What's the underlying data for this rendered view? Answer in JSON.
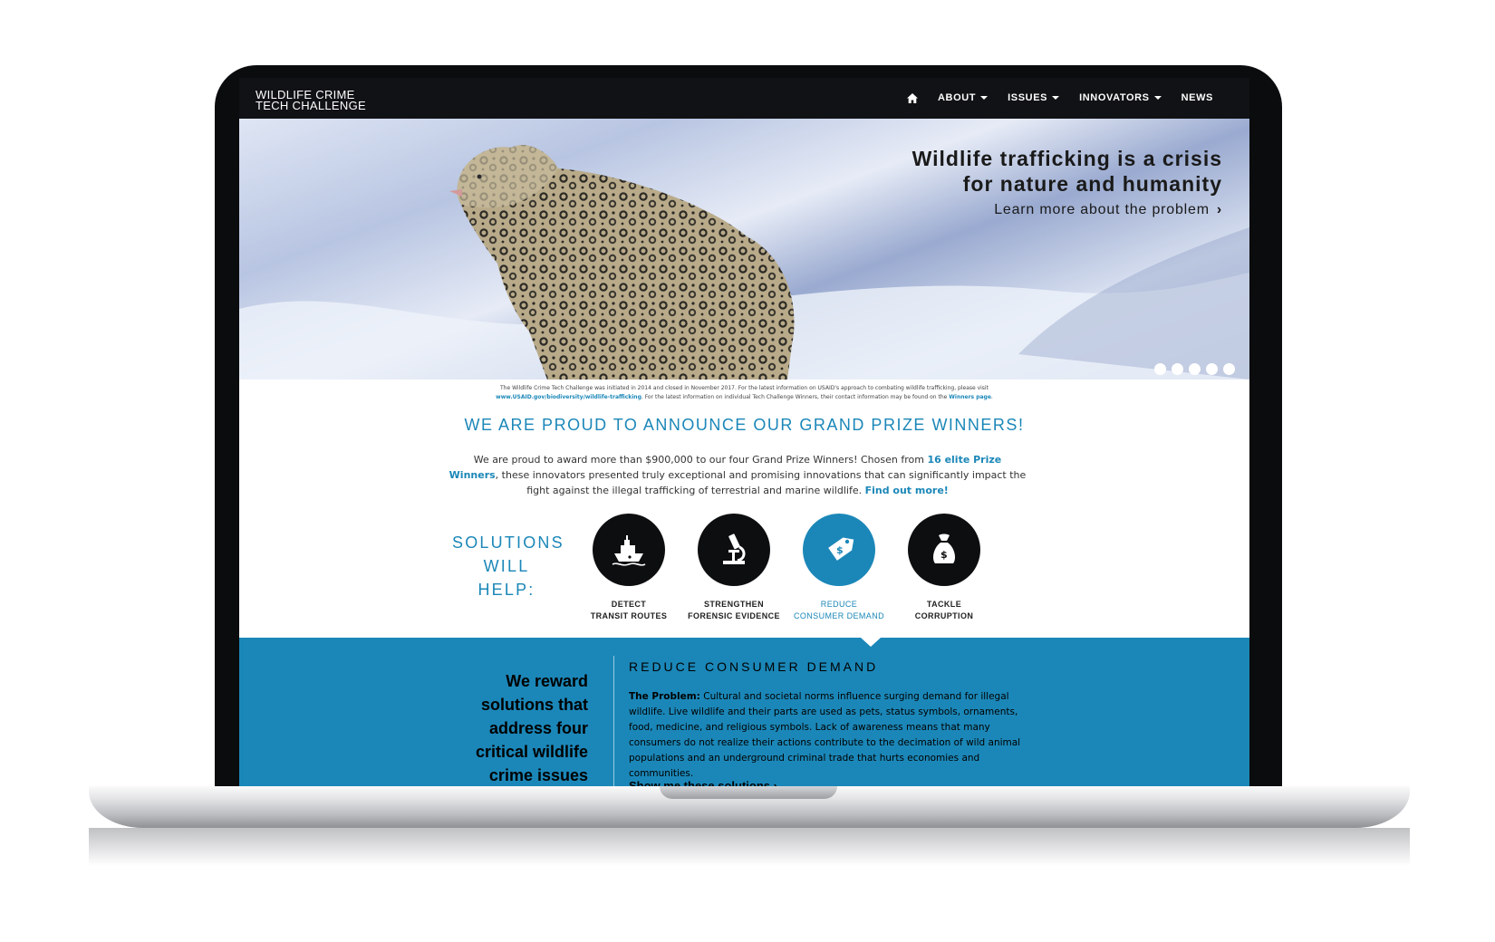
{
  "site": {
    "logo_line1": "WILDLIFE CRIME",
    "logo_line2": "TECH CHALLENGE"
  },
  "nav": {
    "home_icon": "home-icon",
    "items": [
      {
        "label": "ABOUT",
        "dropdown": true
      },
      {
        "label": "ISSUES",
        "dropdown": true
      },
      {
        "label": "INNOVATORS",
        "dropdown": true
      },
      {
        "label": "NEWS",
        "dropdown": false
      }
    ]
  },
  "hero": {
    "title": "Wildlife trafficking is a crisis\nfor nature and humanity",
    "link": "Learn more about the problem",
    "slides": 5
  },
  "notice": {
    "text1": "The Wildlife Crime Tech Challenge was initiated in 2014 and closed in November 2017. For the latest information on USAID's approach to combating wildlife trafficking, please visit",
    "link1": "www.USAID.gov/biodiversity/wildlife-trafficking",
    "text2": ". For the latest information on individual Tech Challenge Winners, their contact information may be found on the",
    "link2": "Winners page",
    "text3": "."
  },
  "announce": {
    "title": "WE ARE PROUD TO ANNOUNCE OUR GRAND PRIZE WINNERS!"
  },
  "intro": {
    "text1": "We are proud to award more than $900,000 to our four Grand Prize Winners! Chosen from",
    "link1": "16 elite Prize Winners",
    "text2": ", these innovators presented truly exceptional and promising innovations that can significantly impact the fight against the illegal trafficking of terrestrial and marine wildlife.",
    "link2": "Find out more!"
  },
  "solutions": {
    "label": "SOLUTIONS\nWILL HELP:",
    "items": [
      {
        "caption": "DETECT\nTRANSIT ROUTES",
        "icon": "ship-icon",
        "active": false
      },
      {
        "caption": "STRENGTHEN\nFORENSIC EVIDENCE",
        "icon": "microscope-icon",
        "active": false
      },
      {
        "caption": "REDUCE\nCONSUMER DEMAND",
        "icon": "price-tag-icon",
        "active": true
      },
      {
        "caption": "TACKLE\nCORRUPTION",
        "icon": "money-bag-icon",
        "active": false
      }
    ]
  },
  "panel": {
    "reward": "We reward\nsolutions that\naddress four\ncritical wildlife\ncrime issues",
    "heading": "REDUCE CONSUMER DEMAND",
    "problem_label": "The Problem:",
    "problem_text": "Cultural and societal norms influence surging demand for illegal wildlife. Live wildlife and their parts are used as pets, status symbols, ornaments, food, medicine, and religious symbols. Lack of awareness means that many consumers do not realize their actions contribute to the decimation of wild animal populations and an underground criminal trade that hurts economies and communities.",
    "link": "Show me these solutions"
  },
  "colors": {
    "accent": "#1b87b8",
    "navbar": "#111215",
    "icon_circle": "#0d0e10"
  }
}
